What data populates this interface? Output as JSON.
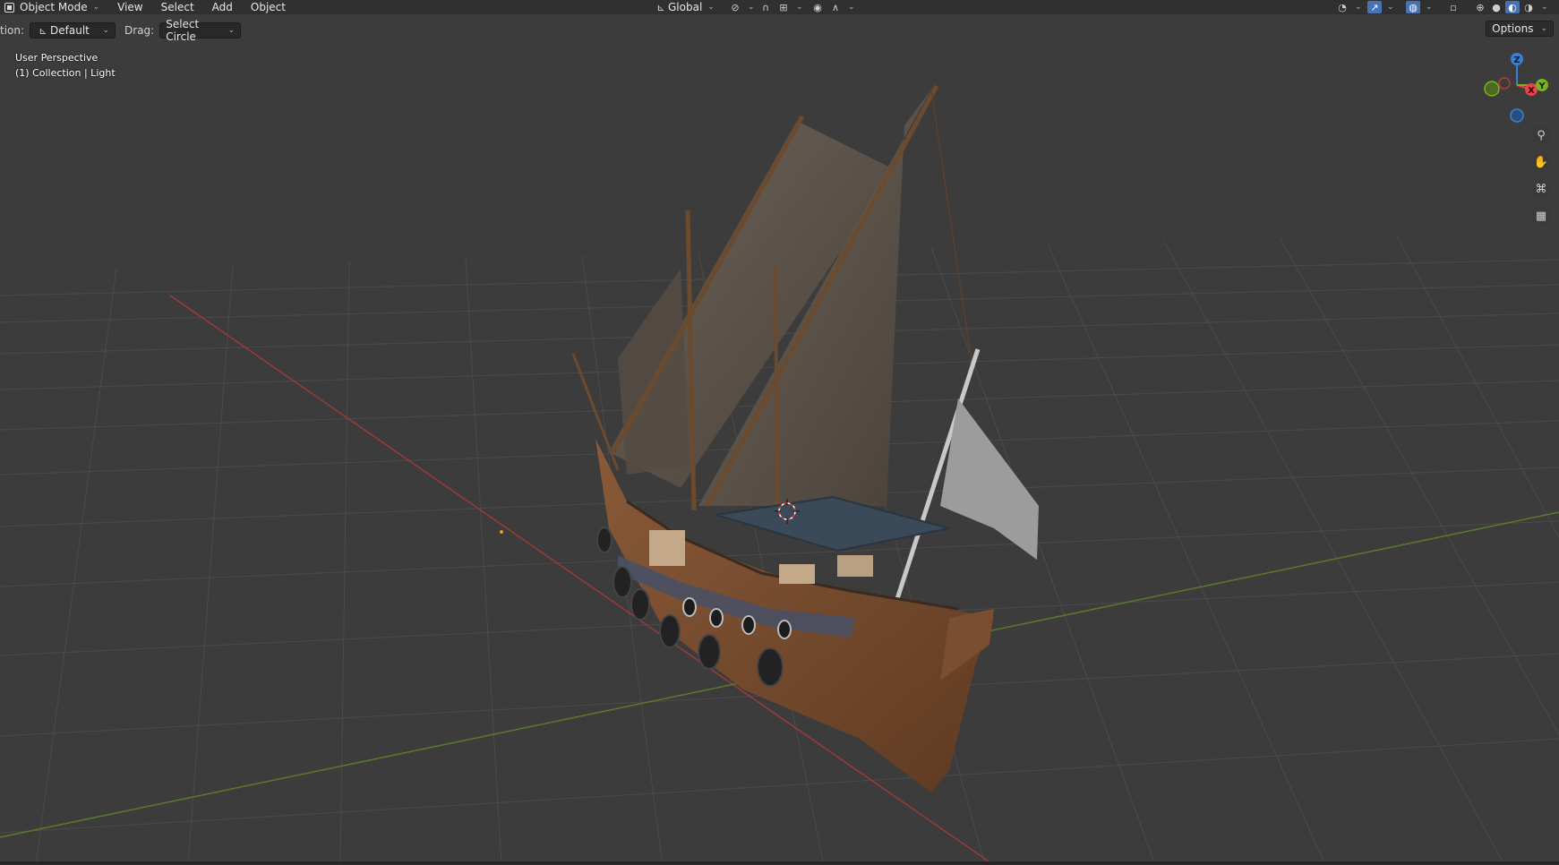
{
  "header": {
    "mode": "Object Mode",
    "menus": [
      "View",
      "Select",
      "Add",
      "Object"
    ],
    "transform_orientation": "Global"
  },
  "toolbar": {
    "orientation_label": "tion:",
    "orientation_value": "Default",
    "drag_label": "Drag:",
    "drag_value": "Select Circle",
    "options_label": "Options"
  },
  "viewport": {
    "perspective": "User Perspective",
    "collection": "(1) Collection | Light"
  },
  "gizmo": {
    "axis_z": "Z",
    "axis_x": "X",
    "axis_y": "Y",
    "x_color": "#e8424a",
    "y_color": "#77b223",
    "z_color": "#3b7fd3"
  },
  "nav_icons": [
    "zoom-icon",
    "pan-hand-icon",
    "camera-view-icon",
    "ortho-grid-icon"
  ],
  "colors": {
    "background": "#3c3c3c",
    "grid": "#4a4a4a",
    "x_axis_line": "#9a3a3a",
    "y_axis_line": "#5b7a2a"
  }
}
